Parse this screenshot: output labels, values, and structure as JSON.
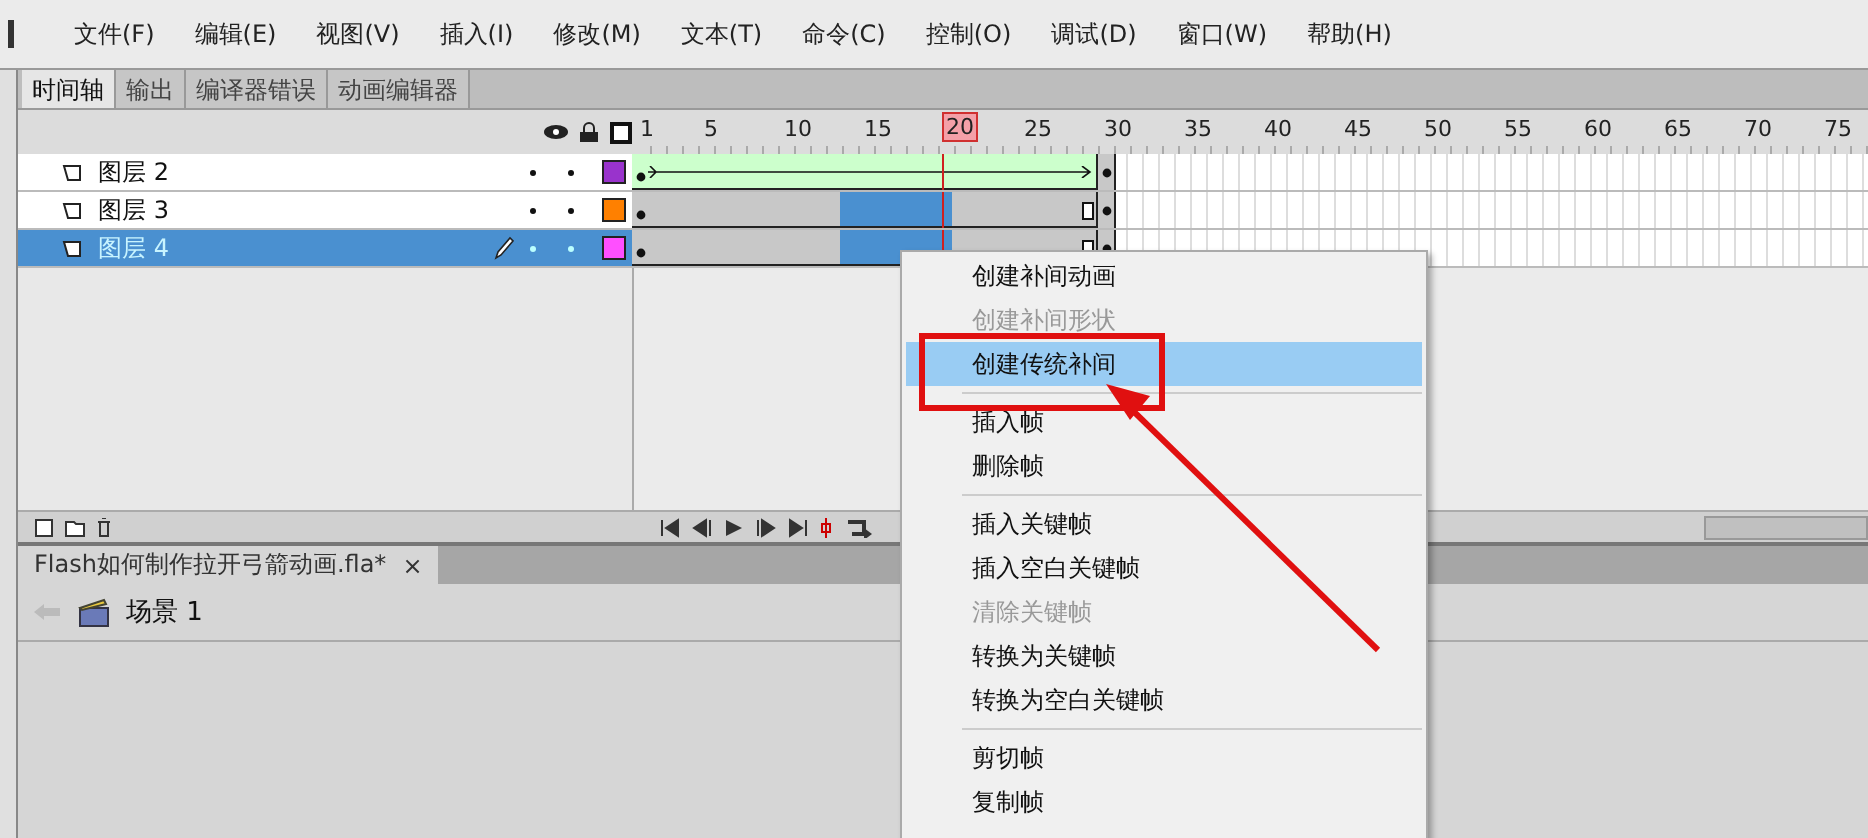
{
  "menu_bar": [
    "文件(F)",
    "编辑(E)",
    "视图(V)",
    "插入(I)",
    "修改(M)",
    "文本(T)",
    "命令(C)",
    "控制(O)",
    "调试(D)",
    "窗口(W)",
    "帮助(H)"
  ],
  "panel_tabs": [
    {
      "label": "时间轴",
      "selected": true
    },
    {
      "label": "输出",
      "selected": false
    },
    {
      "label": "编译器错误",
      "selected": false
    },
    {
      "label": "动画编辑器",
      "selected": false
    }
  ],
  "ruler": [
    {
      "label": "1",
      "playhead": false
    },
    {
      "label": "5",
      "playhead": false
    },
    {
      "label": "10",
      "playhead": false
    },
    {
      "label": "15",
      "playhead": false
    },
    {
      "label": "20",
      "playhead": true
    },
    {
      "label": "25",
      "playhead": false
    },
    {
      "label": "30",
      "playhead": false
    },
    {
      "label": "35",
      "playhead": false
    },
    {
      "label": "40",
      "playhead": false
    },
    {
      "label": "45",
      "playhead": false
    },
    {
      "label": "50",
      "playhead": false
    },
    {
      "label": "55",
      "playhead": false
    },
    {
      "label": "60",
      "playhead": false
    },
    {
      "label": "65",
      "playhead": false
    },
    {
      "label": "70",
      "playhead": false
    },
    {
      "label": "75",
      "playhead": false
    }
  ],
  "layers": [
    {
      "name": "图层 2",
      "selected": false,
      "editing": false,
      "color": "#9933cc",
      "kind": "tween",
      "frames_selected": false
    },
    {
      "name": "图层 3",
      "selected": false,
      "editing": false,
      "color": "#ff8000",
      "kind": "static",
      "frames_selected": true
    },
    {
      "name": "图层 4",
      "selected": true,
      "editing": true,
      "color": "#ff4fff",
      "kind": "static",
      "frames_selected": true
    }
  ],
  "document_tab": {
    "title": "Flash如何制作拉开弓箭动画.fla*",
    "close": "×"
  },
  "scene": "场景 1",
  "context_menu": [
    {
      "kind": "item",
      "label": "创建补间动画",
      "disabled": false,
      "selected": false
    },
    {
      "kind": "item",
      "label": "创建补间形状",
      "disabled": true,
      "selected": false
    },
    {
      "kind": "item",
      "label": "创建传统补间",
      "disabled": false,
      "selected": true
    },
    {
      "kind": "separator"
    },
    {
      "kind": "item",
      "label": "插入帧",
      "disabled": false,
      "selected": false
    },
    {
      "kind": "item",
      "label": "删除帧",
      "disabled": false,
      "selected": false
    },
    {
      "kind": "separator"
    },
    {
      "kind": "item",
      "label": "插入关键帧",
      "disabled": false,
      "selected": false
    },
    {
      "kind": "item",
      "label": "插入空白关键帧",
      "disabled": false,
      "selected": false
    },
    {
      "kind": "item",
      "label": "清除关键帧",
      "disabled": true,
      "selected": false
    },
    {
      "kind": "item",
      "label": "转换为关键帧",
      "disabled": false,
      "selected": false
    },
    {
      "kind": "item",
      "label": "转换为空白关键帧",
      "disabled": false,
      "selected": false
    },
    {
      "kind": "separator"
    },
    {
      "kind": "item",
      "label": "剪切帧",
      "disabled": false,
      "selected": false
    },
    {
      "kind": "item",
      "label": "复制帧",
      "disabled": false,
      "selected": false
    }
  ]
}
